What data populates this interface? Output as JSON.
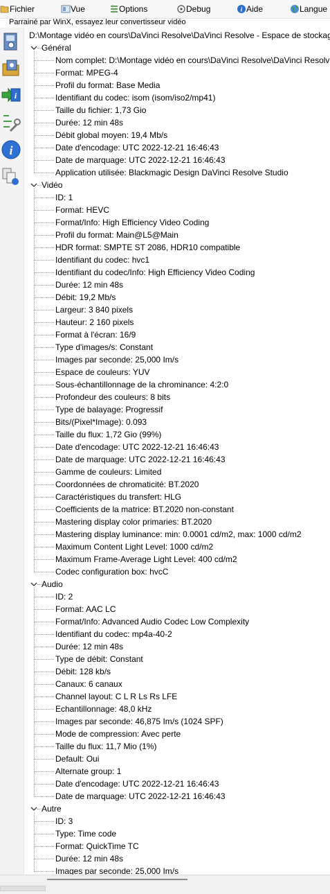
{
  "menu": [
    {
      "label": "Fichier",
      "icon": "folder-open-icon"
    },
    {
      "label": "Vue",
      "icon": "view-icon"
    },
    {
      "label": "Options",
      "icon": "options-icon"
    },
    {
      "label": "Debug",
      "icon": "debug-icon"
    },
    {
      "label": "Aide",
      "icon": "help-icon"
    },
    {
      "label": "Langue",
      "icon": "globe-icon"
    }
  ],
  "sponsor_text": "Parrainé par WinX, essayez leur convertisseur vidéo",
  "sidebar_icons": [
    "open-file-icon",
    "open-folder-icon",
    "export-icon",
    "preferences-icon",
    "about-icon",
    "compare-icon"
  ],
  "tree": {
    "root": "D:\\Montage vidéo en cours\\DaVinci Resolve\\DaVinci Resolve - Espace de stockage\\",
    "sections": [
      {
        "name": "Général",
        "items": [
          "Nom complet: D:\\Montage vidéo en cours\\DaVinci Resolve\\DaVinci Resolve - Espace de stockage\\",
          "Format: MPEG-4",
          "Profil du format: Base Media",
          "Identifiant du codec: isom (isom/iso2/mp41)",
          "Taille du fichier: 1,73 Gio",
          "Durée: 12 min 48s",
          "Débit global moyen: 19,4 Mb/s",
          "Date d'encodage: UTC 2022-12-21 16:46:43",
          "Date de marquage: UTC 2022-12-21 16:46:43",
          "Application utilisée: Blackmagic Design DaVinci Resolve Studio"
        ]
      },
      {
        "name": "Vidéo",
        "items": [
          "ID: 1",
          "Format: HEVC",
          "Format/Info: High Efficiency Video Coding",
          "Profil du format: Main@L5@Main",
          "HDR format: SMPTE ST 2086, HDR10 compatible",
          "Identifiant du codec: hvc1",
          "Identifiant du codec/Info: High Efficiency Video Coding",
          "Durée: 12 min 48s",
          "Débit: 19,2 Mb/s",
          "Largeur: 3 840 pixels",
          "Hauteur: 2 160 pixels",
          "Format à l'écran: 16/9",
          "Type d'images/s: Constant",
          "Images par seconde: 25,000 Im/s",
          "Espace de couleurs: YUV",
          "Sous-échantillonnage de la chrominance: 4:2:0",
          "Profondeur des couleurs: 8 bits",
          "Type de balayage: Progressif",
          "Bits/(Pixel*Image): 0.093",
          "Taille du flux: 1,72 Gio (99%)",
          "Date d'encodage: UTC 2022-12-21 16:46:43",
          "Date de marquage: UTC 2022-12-21 16:46:43",
          "Gamme de couleurs: Limited",
          "Coordonnées de chromaticité: BT.2020",
          "Caractéristiques du transfert: HLG",
          "Coefficients de la matrice: BT.2020 non-constant",
          "Mastering display color primaries: BT.2020",
          "Mastering display luminance: min: 0.0001 cd/m2, max: 1000 cd/m2",
          "Maximum Content Light Level: 1000 cd/m2",
          "Maximum Frame-Average Light Level: 400 cd/m2",
          "Codec configuration box: hvcC"
        ]
      },
      {
        "name": "Audio",
        "items": [
          "ID: 2",
          "Format: AAC LC",
          "Format/Info: Advanced Audio Codec Low Complexity",
          "Identifiant du codec: mp4a-40-2",
          "Durée: 12 min 48s",
          "Type de débit: Constant",
          "Débit: 128 kb/s",
          "Canaux: 6 canaux",
          "Channel layout: C L R Ls Rs LFE",
          "Echantillonnage: 48,0 kHz",
          "Images par seconde: 46,875 Im/s (1024 SPF)",
          "Mode de compression: Avec perte",
          "Taille du flux: 11,7 Mio (1%)",
          "Default: Oui",
          "Alternate group: 1",
          "Date d'encodage: UTC 2022-12-21 16:46:43",
          "Date de marquage: UTC 2022-12-21 16:46:43"
        ]
      },
      {
        "name": "Autre",
        "items": [
          "ID: 3",
          "Type: Time code",
          "Format: QuickTime TC",
          "Durée: 12 min 48s",
          "Images par seconde: 25,000 Im/s"
        ]
      }
    ]
  }
}
